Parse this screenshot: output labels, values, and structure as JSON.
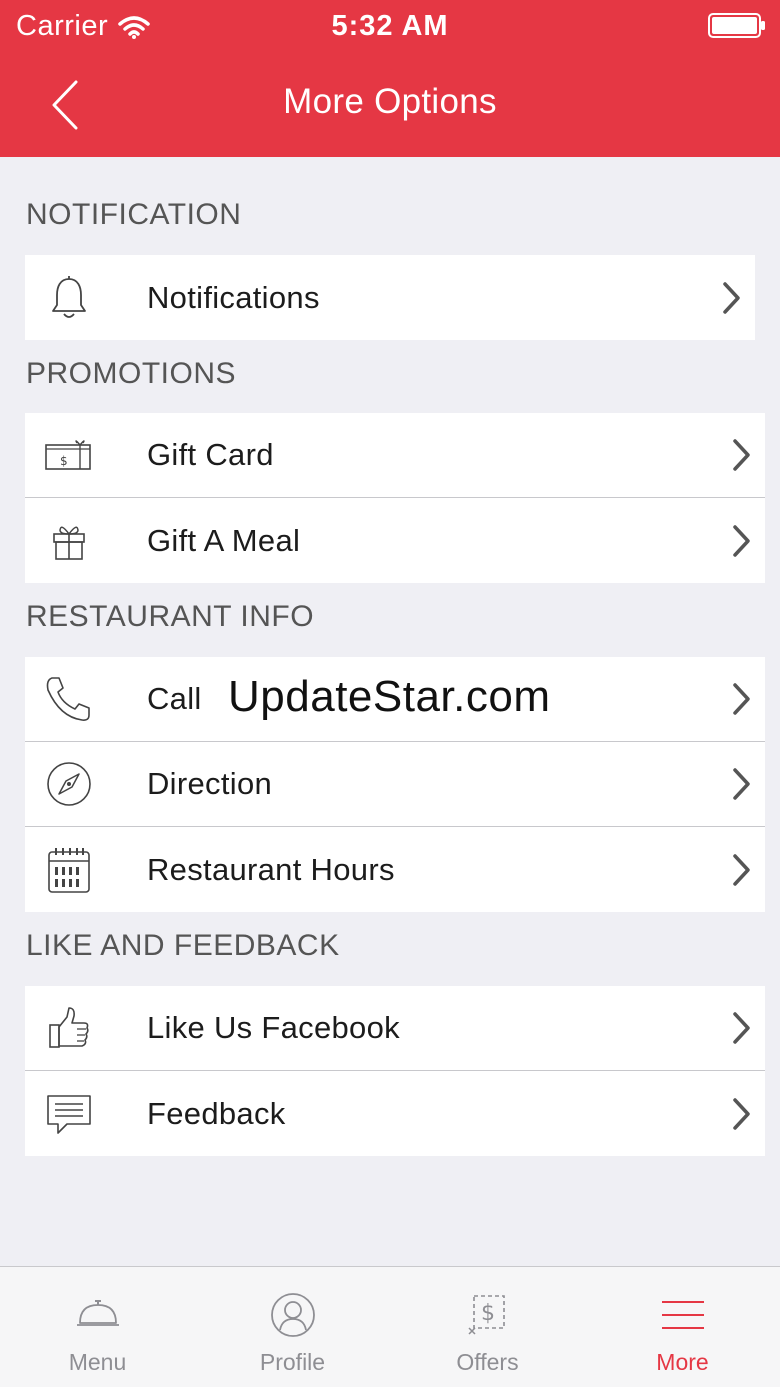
{
  "status_bar": {
    "carrier": "Carrier",
    "time": "5:32 AM"
  },
  "nav": {
    "title": "More Options",
    "back_icon": "chevron-left-icon"
  },
  "colors": {
    "accent": "#e53744",
    "background": "#efeff4",
    "tab_inactive": "#8e8e93"
  },
  "sections": [
    {
      "title": "NOTIFICATION",
      "items": [
        {
          "label": "Notifications",
          "icon": "bell-icon"
        }
      ]
    },
    {
      "title": "PROMOTIONS",
      "items": [
        {
          "label": "Gift Card",
          "icon": "gift-card-icon"
        },
        {
          "label": "Gift A Meal",
          "icon": "gift-box-icon"
        }
      ]
    },
    {
      "title": "RESTAURANT INFO",
      "items": [
        {
          "label": "Call",
          "icon": "phone-icon"
        },
        {
          "label": "Direction",
          "icon": "compass-icon"
        },
        {
          "label": "Restaurant Hours",
          "icon": "calendar-icon"
        }
      ]
    },
    {
      "title": "LIKE AND FEEDBACK",
      "items": [
        {
          "label": "Like Us Facebook",
          "icon": "thumbs-up-icon"
        },
        {
          "label": "Feedback",
          "icon": "chat-bubble-icon"
        }
      ]
    }
  ],
  "watermark": "UpdateStar.com",
  "tabbar": {
    "tabs": [
      {
        "label": "Menu",
        "icon": "cloche-icon",
        "active": false
      },
      {
        "label": "Profile",
        "icon": "user-circle-icon",
        "active": false
      },
      {
        "label": "Offers",
        "icon": "coupon-icon",
        "active": false
      },
      {
        "label": "More",
        "icon": "hamburger-icon",
        "active": true
      }
    ]
  }
}
